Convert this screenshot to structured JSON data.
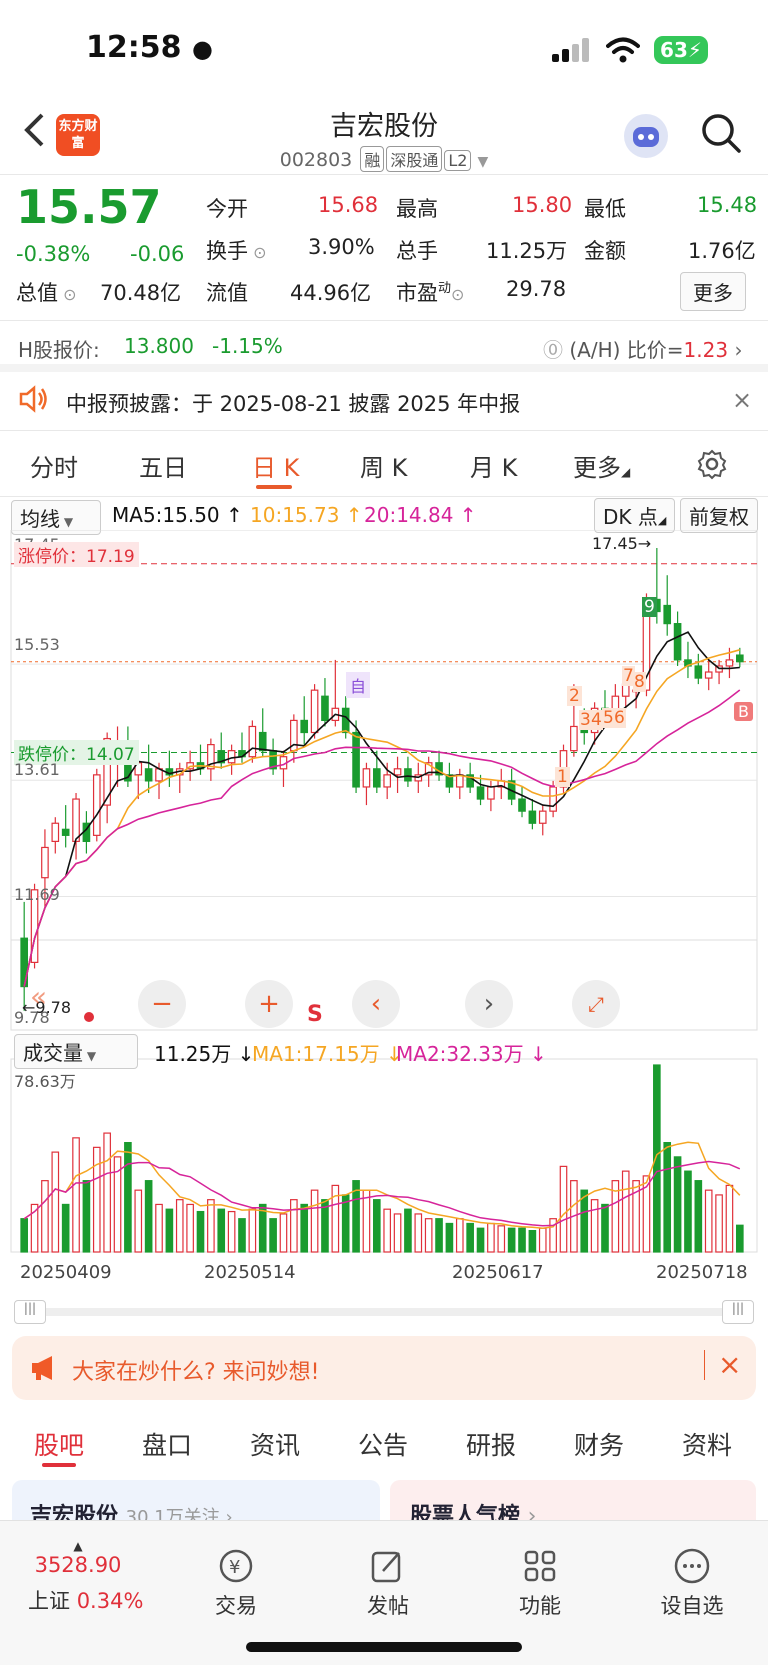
{
  "status": {
    "time": "12:58",
    "battery": "63"
  },
  "header": {
    "logo": "东方财富",
    "title": "吉宏股份",
    "code": "002803",
    "tags": [
      "融",
      "深股通",
      "L2"
    ]
  },
  "quote": {
    "price": "15.57",
    "change_pct": "-0.38%",
    "change": "-0.06",
    "open_label": "今开",
    "open": "15.68",
    "high_label": "最高",
    "high": "15.80",
    "low_label": "最低",
    "low": "15.48",
    "turnover_label": "换手",
    "turnover": "3.90%",
    "volume_label": "总手",
    "volume": "11.25万",
    "amount_label": "金额",
    "amount": "1.76亿",
    "mktcap_label": "总值",
    "mktcap": "70.48亿",
    "float_label": "流值",
    "float": "44.96亿",
    "pe_label": "市盈",
    "pe_sup": "动",
    "pe": "29.78",
    "more": "更多"
  },
  "hshare": {
    "label": "H股报价:",
    "price": "13.800",
    "pct": "-1.15%",
    "ratio_label": "(A/H) 比价=",
    "ratio": "1.23"
  },
  "notice": {
    "text": "中报预披露：于 2025-08-21 披露 2025 年中报"
  },
  "tabs": [
    "分时",
    "五日",
    "日 K",
    "周 K",
    "月 K",
    "更多"
  ],
  "active_tab": "日 K",
  "chart_controls": {
    "ma_select": "均线",
    "ma5": "MA5:15.50",
    "ma10": "10:15.73",
    "ma20": "20:14.84",
    "dk": "DK 点",
    "adjust": "前复权",
    "limit_up": "涨停价：17.19",
    "limit_down": "跌停价：14.07",
    "y_top": "17.45",
    "y_mid1": "15.53",
    "y_mid2": "13.61",
    "y_mid3": "11.69",
    "y_low": "9.78",
    "max_label": "17.45→",
    "min_label": "←9.78",
    "self_mark": "自",
    "b_mark": "B",
    "s_mark": "S",
    "signals": [
      "1",
      "2",
      "3",
      "4",
      "5",
      "6",
      "7",
      "8",
      "9"
    ],
    "vol_select": "成交量",
    "vol": "11.25万",
    "vol_ma1": "MA1:17.15万",
    "vol_ma2": "MA2:32.33万",
    "vol_max": "78.63万",
    "dates": [
      "20250409",
      "20250514",
      "20250617",
      "20250718"
    ]
  },
  "colors": {
    "up": "#e0303a",
    "down": "#1a9b2f",
    "ma5": "#111111",
    "ma10": "#f5a623",
    "ma20": "#d6249a"
  },
  "chart_data": {
    "type": "candlestick",
    "ylim": [
      9.78,
      17.45
    ],
    "limit_up": 17.19,
    "limit_down": 14.07,
    "candles": [
      [
        11.0,
        11.6,
        9.8,
        10.2
      ],
      [
        10.6,
        11.9,
        10.5,
        11.8
      ],
      [
        12.0,
        12.8,
        11.5,
        12.5
      ],
      [
        12.6,
        13.0,
        12.4,
        12.9
      ],
      [
        12.8,
        13.2,
        12.5,
        12.7
      ],
      [
        12.6,
        13.4,
        12.3,
        13.3
      ],
      [
        12.9,
        13.1,
        12.4,
        12.6
      ],
      [
        12.7,
        13.8,
        12.6,
        13.7
      ],
      [
        13.2,
        14.4,
        12.9,
        14.3
      ],
      [
        13.9,
        14.5,
        13.5,
        14.1
      ],
      [
        14.2,
        14.5,
        13.5,
        13.6
      ],
      [
        13.7,
        14.0,
        13.3,
        13.9
      ],
      [
        13.8,
        14.2,
        13.4,
        13.6
      ],
      [
        13.6,
        13.9,
        13.3,
        13.8
      ],
      [
        13.8,
        14.1,
        13.5,
        13.7
      ],
      [
        13.7,
        13.9,
        13.4,
        13.8
      ],
      [
        13.8,
        14.1,
        13.6,
        13.9
      ],
      [
        13.9,
        14.2,
        13.7,
        13.8
      ],
      [
        13.8,
        14.3,
        13.6,
        14.2
      ],
      [
        14.1,
        14.4,
        13.8,
        13.9
      ],
      [
        13.9,
        14.2,
        13.7,
        14.1
      ],
      [
        14.1,
        14.4,
        13.9,
        14.0
      ],
      [
        14.0,
        14.6,
        13.9,
        14.5
      ],
      [
        14.4,
        14.8,
        14.0,
        14.1
      ],
      [
        14.1,
        14.3,
        13.7,
        13.8
      ],
      [
        13.8,
        14.1,
        13.5,
        14.0
      ],
      [
        14.1,
        14.7,
        13.9,
        14.6
      ],
      [
        14.6,
        15.0,
        14.2,
        14.4
      ],
      [
        14.4,
        15.2,
        14.3,
        15.1
      ],
      [
        15.0,
        15.3,
        14.5,
        14.6
      ],
      [
        14.6,
        15.6,
        14.5,
        14.8
      ],
      [
        14.8,
        15.0,
        14.3,
        14.4
      ],
      [
        14.4,
        14.6,
        13.4,
        13.5
      ],
      [
        13.5,
        13.9,
        13.2,
        13.8
      ],
      [
        13.8,
        14.1,
        13.4,
        13.5
      ],
      [
        13.5,
        13.9,
        13.3,
        13.7
      ],
      [
        13.7,
        14.0,
        13.4,
        13.8
      ],
      [
        13.8,
        14.0,
        13.5,
        13.6
      ],
      [
        13.6,
        13.9,
        13.4,
        13.7
      ],
      [
        13.7,
        14.0,
        13.5,
        13.9
      ],
      [
        13.9,
        14.1,
        13.6,
        13.7
      ],
      [
        13.7,
        13.9,
        13.4,
        13.5
      ],
      [
        13.5,
        13.8,
        13.3,
        13.7
      ],
      [
        13.7,
        13.9,
        13.4,
        13.5
      ],
      [
        13.5,
        13.7,
        13.2,
        13.3
      ],
      [
        13.3,
        13.6,
        13.1,
        13.5
      ],
      [
        13.5,
        13.8,
        13.3,
        13.6
      ],
      [
        13.6,
        13.8,
        13.2,
        13.3
      ],
      [
        13.3,
        13.5,
        13.0,
        13.1
      ],
      [
        13.1,
        13.3,
        12.8,
        12.9
      ],
      [
        12.9,
        13.2,
        12.7,
        13.1
      ],
      [
        13.1,
        13.6,
        13.0,
        13.5
      ],
      [
        13.5,
        14.2,
        13.4,
        14.1
      ],
      [
        14.1,
        15.2,
        14.0,
        14.5
      ],
      [
        14.5,
        14.8,
        14.2,
        14.4
      ],
      [
        14.4,
        14.9,
        14.2,
        14.8
      ],
      [
        14.8,
        15.1,
        14.5,
        14.7
      ],
      [
        14.7,
        15.2,
        14.6,
        15.0
      ],
      [
        15.0,
        15.4,
        14.8,
        15.2
      ],
      [
        15.1,
        15.3,
        14.8,
        15.1
      ],
      [
        15.1,
        16.7,
        15.0,
        16.6
      ],
      [
        16.6,
        17.45,
        16.2,
        16.4
      ],
      [
        16.5,
        17.0,
        16.0,
        16.2
      ],
      [
        16.2,
        16.4,
        15.5,
        15.6
      ],
      [
        15.6,
        15.9,
        15.3,
        15.5
      ],
      [
        15.5,
        15.7,
        15.2,
        15.3
      ],
      [
        15.3,
        15.6,
        15.1,
        15.4
      ],
      [
        15.4,
        15.6,
        15.2,
        15.5
      ],
      [
        15.5,
        15.8,
        15.3,
        15.6
      ],
      [
        15.68,
        15.8,
        15.48,
        15.57
      ]
    ],
    "volume": [
      14,
      20,
      30,
      42,
      20,
      48,
      30,
      44,
      50,
      40,
      46,
      26,
      30,
      20,
      18,
      22,
      20,
      17,
      22,
      18,
      17,
      14,
      18,
      20,
      14,
      16,
      22,
      20,
      26,
      22,
      28,
      24,
      30,
      26,
      22,
      18,
      16,
      18,
      16,
      14,
      14,
      12,
      14,
      12,
      10,
      12,
      11,
      10,
      10,
      9,
      10,
      14,
      36,
      30,
      26,
      22,
      20,
      30,
      34,
      30,
      32,
      78.63,
      46,
      40,
      34,
      30,
      26,
      24,
      28,
      11.25
    ]
  }
}
